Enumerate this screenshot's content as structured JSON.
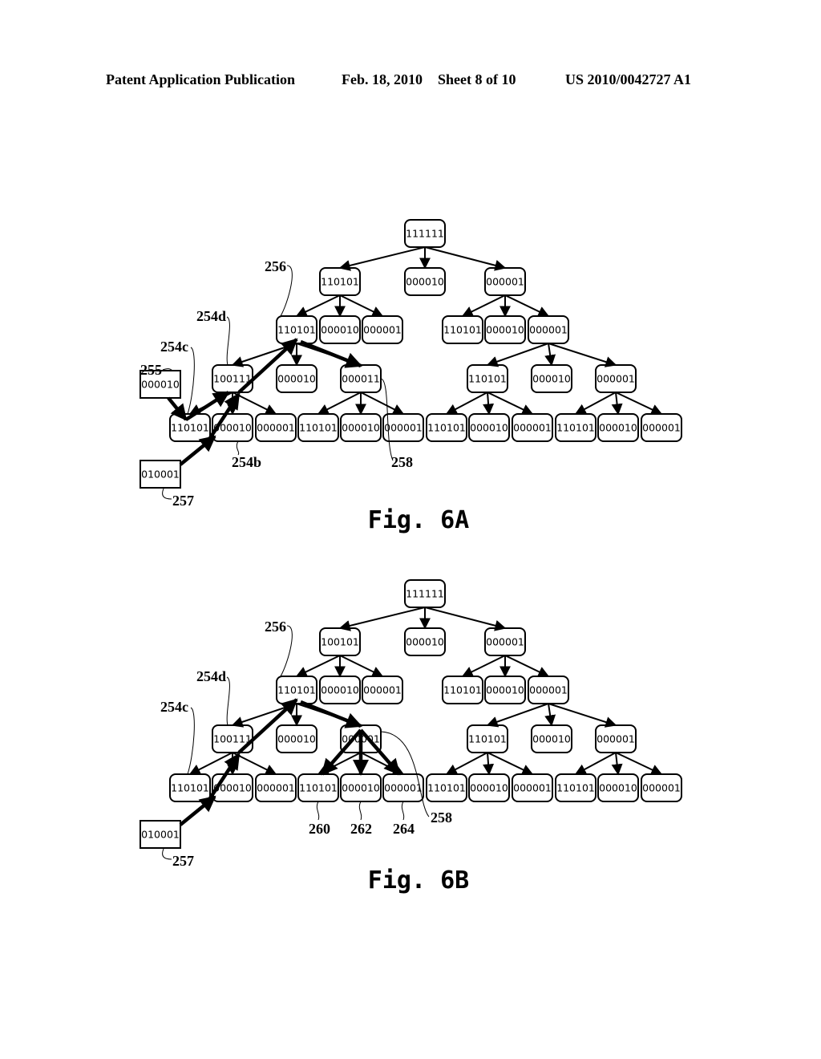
{
  "header": {
    "left": "Patent Application Publication",
    "date": "Feb. 18, 2010",
    "sheet": "Sheet 8 of 10",
    "number": "US 2010/0042727 A1"
  },
  "figures": [
    {
      "id": "6A",
      "title": "Fig. 6A",
      "root": "111111",
      "level1": [
        "110101",
        "000010",
        "000001"
      ],
      "level2_left": [
        "110101",
        "000010",
        "000001"
      ],
      "level2_right": [
        "110101",
        "000010",
        "000001"
      ],
      "level3_left": [
        "100111",
        "000010",
        "000011"
      ],
      "level3_right": [
        "110101",
        "000010",
        "000001"
      ],
      "level4": [
        "110101",
        "000010",
        "000001",
        "110101",
        "000010",
        "000001",
        "110101",
        "000010",
        "000001",
        "110101",
        "000010",
        "000001"
      ],
      "external_nodes": [
        {
          "value": "000010",
          "ref": "255"
        },
        {
          "value": "010001",
          "ref": "257"
        }
      ],
      "refs": [
        "256",
        "254d",
        "254c",
        "255",
        "254b",
        "257",
        "258"
      ]
    },
    {
      "id": "6B",
      "title": "Fig. 6B",
      "root": "111111",
      "level1": [
        "100101",
        "000010",
        "000001"
      ],
      "level2_left": [
        "110101",
        "000010",
        "000001"
      ],
      "level2_right": [
        "110101",
        "000010",
        "000001"
      ],
      "level3_left": [
        "100111",
        "000010",
        "000001"
      ],
      "level3_right": [
        "110101",
        "000010",
        "000001"
      ],
      "level4": [
        "110101",
        "000010",
        "000001",
        "110101",
        "000010",
        "000001",
        "110101",
        "000010",
        "000001",
        "110101",
        "000010",
        "000001"
      ],
      "external_nodes": [
        {
          "value": "010001",
          "ref": "257"
        }
      ],
      "refs": [
        "256",
        "254d",
        "254c",
        "257",
        "258",
        "260",
        "262",
        "264"
      ]
    }
  ]
}
